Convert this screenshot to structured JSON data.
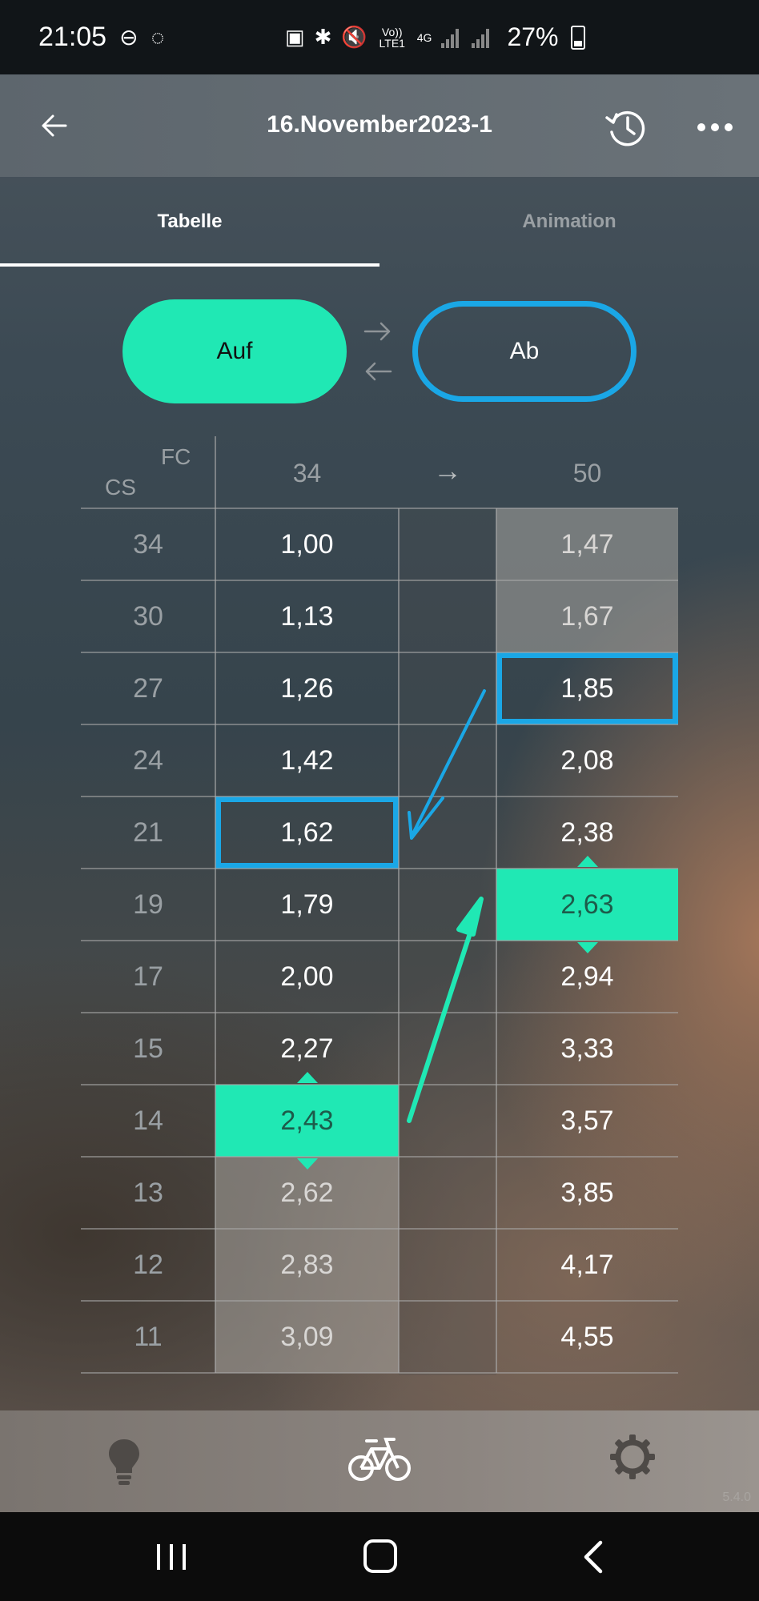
{
  "status_bar": {
    "time": "21:05",
    "icons_left": [
      "do-not-disturb-icon",
      "sync-icon"
    ],
    "icons_center": [
      "battery-saver-icon",
      "bluetooth-icon",
      "mute-icon",
      "volte-icon",
      "4g-icon",
      "signal-icon",
      "signal-icon"
    ],
    "volte_label": "Vo)) LTE1",
    "network_label": "4G",
    "battery_text": "27%"
  },
  "app_bar": {
    "title": "16.November2023-1",
    "back_icon": "arrow-left-icon",
    "history_icon": "history-icon",
    "more_icon": "more-horizontal-icon"
  },
  "tabs": [
    {
      "label": "Tabelle",
      "active": true
    },
    {
      "label": "Animation",
      "active": false
    }
  ],
  "toggle": {
    "up_label": "Auf",
    "down_label": "Ab",
    "swap_icon": "swap-arrows-icon"
  },
  "table": {
    "header_fc": "FC",
    "header_cs": "CS",
    "front_teeth": "34",
    "arrow": "→",
    "rear_teeth": "50",
    "rows": [
      {
        "cs": "34",
        "front": "1,00",
        "rear": "1,47"
      },
      {
        "cs": "30",
        "front": "1,13",
        "rear": "1,67"
      },
      {
        "cs": "27",
        "front": "1,26",
        "rear": "1,85"
      },
      {
        "cs": "24",
        "front": "1,42",
        "rear": "2,08"
      },
      {
        "cs": "21",
        "front": "1,62",
        "rear": "2,38"
      },
      {
        "cs": "19",
        "front": "1,79",
        "rear": "2,63"
      },
      {
        "cs": "17",
        "front": "2,00",
        "rear": "2,94"
      },
      {
        "cs": "15",
        "front": "2,27",
        "rear": "3,33"
      },
      {
        "cs": "14",
        "front": "2,43",
        "rear": "3,57"
      },
      {
        "cs": "13",
        "front": "2,62",
        "rear": "3,85"
      },
      {
        "cs": "12",
        "front": "2,83",
        "rear": "4,17"
      },
      {
        "cs": "11",
        "front": "3,09",
        "rear": "4,55"
      }
    ],
    "colors": {
      "active": "#20e8b4",
      "selected_border": "#1aa7e6"
    }
  },
  "bottom_nav": {
    "items": [
      {
        "icon": "lightbulb-icon"
      },
      {
        "icon": "bicycle-icon"
      },
      {
        "icon": "gear-icon"
      }
    ],
    "version": "5.4.0"
  },
  "system_nav": {
    "icons": [
      "recent-apps-icon",
      "home-icon",
      "back-icon"
    ]
  }
}
